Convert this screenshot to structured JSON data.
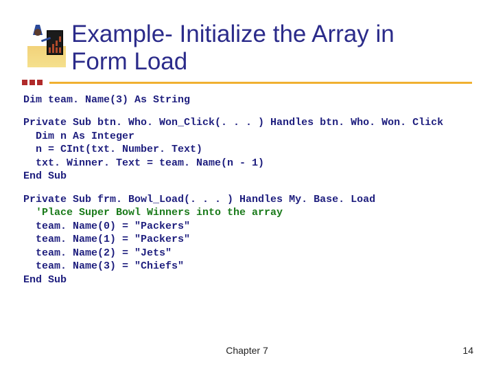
{
  "title_line1": "Example- Initialize the Array in",
  "title_line2": "Form Load",
  "code_block1": "Dim team. Name(3) As String",
  "code_block2_l1": "Private Sub btn. Who. Won_Click(. . . ) Handles btn. Who. Won. Click",
  "code_block2_l2": "  Dim n As Integer",
  "code_block2_l3": "  n = CInt(txt. Number. Text)",
  "code_block2_l4": "  txt. Winner. Text = team. Name(n - 1)",
  "code_block2_l5": "End Sub",
  "code_block3_l1": "Private Sub frm. Bowl_Load(. . . ) Handles My. Base. Load",
  "code_block3_l2": "  'Place Super Bowl Winners into the array",
  "code_block3_l3": "  team. Name(0) = \"Packers\"",
  "code_block3_l4": "  team. Name(1) = \"Packers\"",
  "code_block3_l5": "  team. Name(2) = \"Jets\"",
  "code_block3_l6": "  team. Name(3) = \"Chiefs\"",
  "code_block3_l7": "End Sub",
  "footer": "Chapter 7",
  "page": "14"
}
